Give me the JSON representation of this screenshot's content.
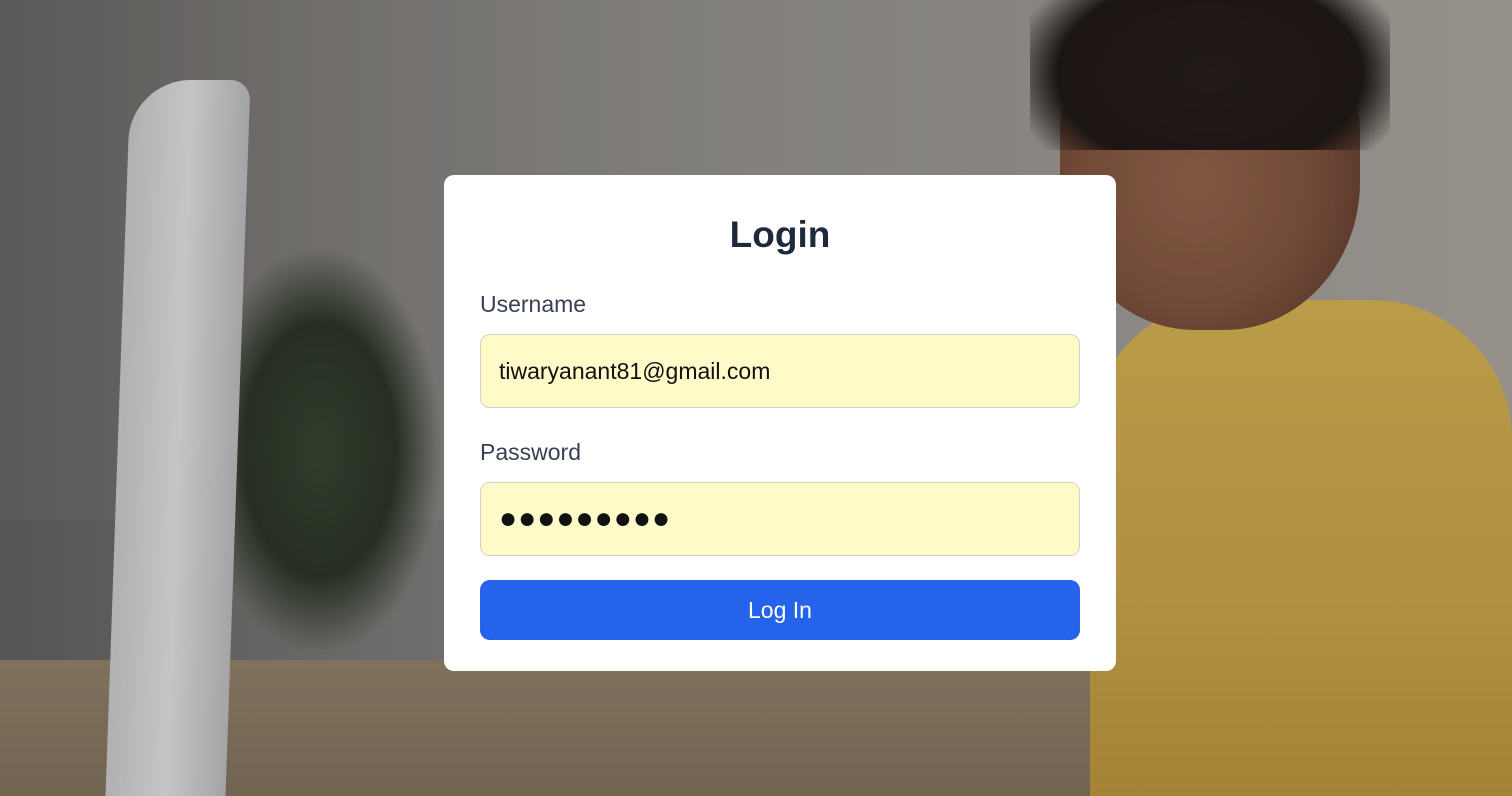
{
  "login": {
    "title": "Login",
    "username_label": "Username",
    "username_value": "tiwaryanant81@gmail.com",
    "password_label": "Password",
    "password_value": "●●●●●●●●●",
    "submit_label": "Log In"
  },
  "colors": {
    "accent": "#2563eb",
    "input_autofill_bg": "#fefbc8",
    "title_text": "#1e293b"
  }
}
